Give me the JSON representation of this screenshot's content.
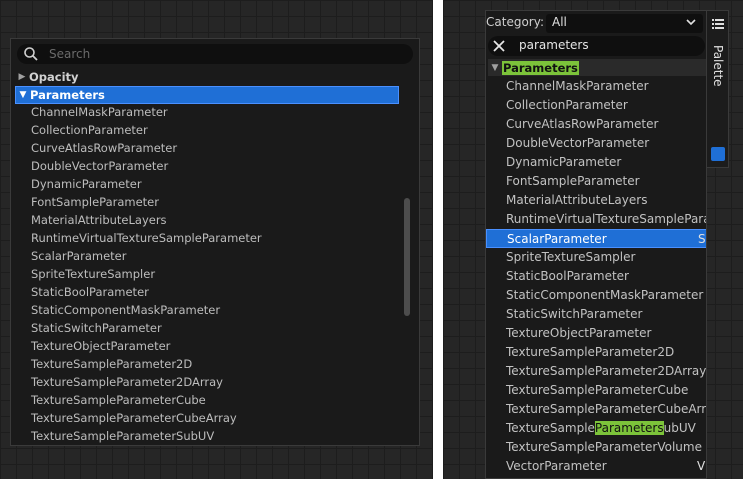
{
  "left_panel": {
    "search": {
      "placeholder": "Search"
    },
    "categories": [
      {
        "label": "Opacity",
        "expanded": false
      },
      {
        "label": "Parameters",
        "expanded": true,
        "selected": true
      }
    ],
    "items": [
      "ChannelMaskParameter",
      "CollectionParameter",
      "CurveAtlasRowParameter",
      "DoubleVectorParameter",
      "DynamicParameter",
      "FontSampleParameter",
      "MaterialAttributeLayers",
      "RuntimeVirtualTextureSampleParameter",
      "ScalarParameter",
      "SpriteTextureSampler",
      "StaticBoolParameter",
      "StaticComponentMaskParameter",
      "StaticSwitchParameter",
      "TextureObjectParameter",
      "TextureSampleParameter2D",
      "TextureSampleParameter2DArray",
      "TextureSampleParameterCube",
      "TextureSampleParameterCubeArray",
      "TextureSampleParameterSubUV"
    ]
  },
  "right_panel": {
    "category_label": "Category:",
    "category_value": "All",
    "search_query": "parameters",
    "category_header": "Parameters",
    "items": [
      {
        "label": "ChannelMaskParameter"
      },
      {
        "label": "CollectionParameter"
      },
      {
        "label": "CurveAtlasRowParameter"
      },
      {
        "label": "DoubleVectorParameter"
      },
      {
        "label": "DynamicParameter"
      },
      {
        "label": "FontSampleParameter"
      },
      {
        "label": "MaterialAttributeLayers"
      },
      {
        "label": "RuntimeVirtualTextureSamplePara"
      },
      {
        "label": "ScalarParameter",
        "selected": true,
        "trail": "S"
      },
      {
        "label": "SpriteTextureSampler"
      },
      {
        "label": "StaticBoolParameter"
      },
      {
        "label": "StaticComponentMaskParameter"
      },
      {
        "label": "StaticSwitchParameter"
      },
      {
        "label": "TextureObjectParameter"
      },
      {
        "label": "TextureSampleParameter2D"
      },
      {
        "label": "TextureSampleParameter2DArray"
      },
      {
        "label": "TextureSampleParameterCube"
      },
      {
        "label": "TextureSampleParameterCubeArra"
      },
      {
        "pre": "TextureSample",
        "hl": "Parameters",
        "post": "ubUV"
      },
      {
        "label": "TextureSampleParameterVolume"
      },
      {
        "label": "VectorParameter",
        "trail": "V"
      }
    ],
    "palette_label": "Palette"
  },
  "colors": {
    "selection": "#1f6fd6",
    "highlight": "#7cc33a",
    "menu_bg": "#1a1a1a"
  }
}
